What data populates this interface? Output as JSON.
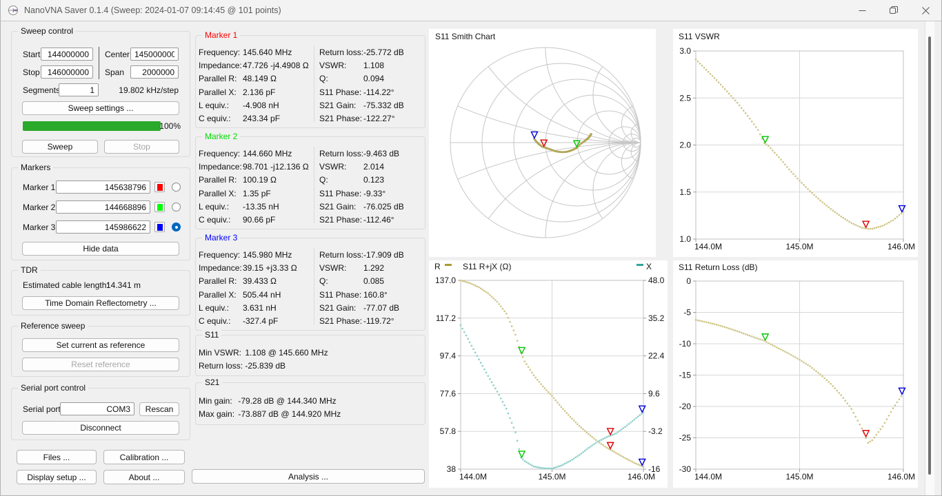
{
  "window": {
    "title": "NanoVNA Saver 0.1.4 (Sweep: 2024-01-07 09:14:45 @ 101 points)"
  },
  "sweep_control": {
    "title": "Sweep control",
    "start_label": "Start",
    "start_value": "144000000",
    "center_label": "Center",
    "center_value": "145000000",
    "stop_label": "Stop",
    "stop_value": "146000000",
    "span_label": "Span",
    "span_value": "2000000",
    "segments_label": "Segments",
    "segments_value": "1",
    "step_text": "19.802 kHz/step",
    "sweep_settings_button": "Sweep settings ...",
    "progress_percent": "100%",
    "sweep_button": "Sweep",
    "stop_button": "Stop"
  },
  "markers_control": {
    "title": "Markers",
    "items": [
      {
        "label": "Marker 1",
        "value": "145638796",
        "color": "#ff0000",
        "selected": false
      },
      {
        "label": "Marker 2",
        "value": "144668896",
        "color": "#00ff00",
        "selected": false
      },
      {
        "label": "Marker 3",
        "value": "145986622",
        "color": "#0000ff",
        "selected": true
      }
    ],
    "hide_data_button": "Hide data"
  },
  "tdr": {
    "title": "TDR",
    "cable_label": "Estimated cable length:",
    "cable_value": "14.341 m",
    "button": "Time Domain Reflectometry ..."
  },
  "reference_sweep": {
    "title": "Reference sweep",
    "set_button": "Set current as reference",
    "reset_button": "Reset reference"
  },
  "serial": {
    "title": "Serial port control",
    "port_label": "Serial port",
    "port_value": "COM3",
    "rescan_button": "Rescan",
    "disconnect_button": "Disconnect"
  },
  "footer_buttons": {
    "files": "Files ...",
    "calibration": "Calibration ...",
    "display_setup": "Display setup ...",
    "about": "About ...",
    "analysis": "Analysis ..."
  },
  "marker_panels": [
    {
      "title": "Marker 1",
      "color": "#ff0000",
      "left": [
        [
          "Frequency:",
          "145.640 MHz"
        ],
        [
          "Impedance:",
          "47.726 -j4.4908 Ω"
        ],
        [
          "Parallel R:",
          "48.149 Ω"
        ],
        [
          "Parallel X:",
          "2.136 pF"
        ],
        [
          "L equiv.:",
          "-4.908 nH"
        ],
        [
          "C equiv.:",
          "243.34 pF"
        ]
      ],
      "right": [
        [
          "Return loss:",
          "-25.772 dB"
        ],
        [
          "VSWR:",
          "1.108"
        ],
        [
          "Q:",
          "0.094"
        ],
        [
          "S11 Phase:",
          "-114.22°"
        ],
        [
          "S21 Gain:",
          "-75.332 dB"
        ],
        [
          "S21 Phase:",
          "-122.27°"
        ]
      ]
    },
    {
      "title": "Marker 2",
      "color": "#00dd00",
      "left": [
        [
          "Frequency:",
          "144.660 MHz"
        ],
        [
          "Impedance:",
          "98.701 -j12.136 Ω"
        ],
        [
          "Parallel R:",
          "100.19 Ω"
        ],
        [
          "Parallel X:",
          "1.35 pF"
        ],
        [
          "L equiv.:",
          "-13.35 nH"
        ],
        [
          "C equiv.:",
          "90.66 pF"
        ]
      ],
      "right": [
        [
          "Return loss:",
          "-9.463 dB"
        ],
        [
          "VSWR:",
          "2.014"
        ],
        [
          "Q:",
          "0.123"
        ],
        [
          "S11 Phase:",
          "-9.33°"
        ],
        [
          "S21 Gain:",
          "-76.025 dB"
        ],
        [
          "S21 Phase:",
          "-112.46°"
        ]
      ]
    },
    {
      "title": "Marker 3",
      "color": "#0000ff",
      "left": [
        [
          "Frequency:",
          "145.980 MHz"
        ],
        [
          "Impedance:",
          "39.15 +j3.33 Ω"
        ],
        [
          "Parallel R:",
          "39.433 Ω"
        ],
        [
          "Parallel X:",
          "505.44 nH"
        ],
        [
          "L equiv.:",
          "3.631 nH"
        ],
        [
          "C equiv.:",
          "-327.4 pF"
        ]
      ],
      "right": [
        [
          "Return loss:",
          "-17.909 dB"
        ],
        [
          "VSWR:",
          "1.292"
        ],
        [
          "Q:",
          "0.085"
        ],
        [
          "S11 Phase:",
          "160.8°"
        ],
        [
          "S21 Gain:",
          "-77.07 dB"
        ],
        [
          "S21 Phase:",
          "-119.72°"
        ]
      ]
    }
  ],
  "s11_panel": {
    "title": "S11",
    "rows": [
      [
        "Min VSWR:",
        "1.108 @ 145.660 MHz"
      ],
      [
        "Return loss:",
        "-25.839 dB"
      ]
    ]
  },
  "s21_panel": {
    "title": "S21",
    "rows": [
      [
        "Min gain:",
        "-79.28 dB @ 144.340 MHz"
      ],
      [
        "Max gain:",
        "-73.887 dB @ 144.920 MHz"
      ]
    ]
  },
  "chart_data": [
    {
      "id": "smith",
      "type": "smith",
      "title": "S11 Smith Chart",
      "z0": 50,
      "r_circles": [
        0.2,
        0.5,
        1,
        2,
        5,
        10,
        20
      ],
      "x_arcs": [
        0.2,
        0.5,
        1,
        2,
        5,
        10
      ],
      "trace_color": "#b3a75a",
      "impedance_source": "rjx",
      "markers": [
        {
          "color": "#00c400",
          "f": 144.6689
        },
        {
          "color": "#dc0000",
          "f": 145.6388
        },
        {
          "color": "#0000d8",
          "f": 145.9866
        }
      ]
    },
    {
      "id": "vswr",
      "type": "line",
      "title": "S11 VSWR",
      "xlim": [
        144.0,
        146.0
      ],
      "xticks": [
        {
          "v": 144.0,
          "label": "144.0M"
        },
        {
          "v": 145.0,
          "label": "145.0M"
        },
        {
          "v": 146.0,
          "label": "146.0M"
        }
      ],
      "axes": [
        {
          "side": "left",
          "lim": [
            1.0,
            3.0
          ],
          "ticks": [
            {
              "v": 3.0,
              "label": "3.0"
            },
            {
              "v": 2.5,
              "label": "2.5"
            },
            {
              "v": 2.0,
              "label": "2.0"
            },
            {
              "v": 1.5,
              "label": "1.5"
            },
            {
              "v": 1.0,
              "label": "1.0"
            }
          ]
        }
      ],
      "series": [
        {
          "name": "VSWR",
          "color": "#cfc589",
          "axis": 0,
          "x": [
            144.0,
            144.1,
            144.2,
            144.3,
            144.4,
            144.5,
            144.6,
            144.66,
            144.7,
            144.8,
            144.9,
            145.0,
            145.1,
            145.2,
            145.3,
            145.4,
            145.5,
            145.6,
            145.66,
            145.7,
            145.8,
            145.9,
            146.0
          ],
          "y": [
            2.91,
            2.8,
            2.69,
            2.57,
            2.45,
            2.31,
            2.16,
            2.02,
            1.99,
            1.87,
            1.74,
            1.62,
            1.51,
            1.41,
            1.32,
            1.24,
            1.17,
            1.12,
            1.108,
            1.11,
            1.14,
            1.2,
            1.29
          ]
        }
      ],
      "markers": [
        {
          "color": "#00c400",
          "f": 144.6689
        },
        {
          "color": "#dc0000",
          "f": 145.6388
        },
        {
          "color": "#0000d8",
          "f": 145.9866
        }
      ]
    },
    {
      "id": "rjx",
      "type": "line",
      "title": "S11 R+jX (Ω)",
      "legend": [
        {
          "label": "R",
          "color": "#ab9b2e"
        },
        {
          "label": "X",
          "color": "#2ea89a"
        }
      ],
      "xlim": [
        144.0,
        146.0
      ],
      "xticks": [
        {
          "v": 144.0,
          "label": "144.0M"
        },
        {
          "v": 145.0,
          "label": "145.0M"
        },
        {
          "v": 146.0,
          "label": "146.0M"
        }
      ],
      "axes": [
        {
          "side": "left",
          "lim": [
            38,
            137
          ],
          "ticks": [
            {
              "v": 137.0,
              "label": "137.0"
            },
            {
              "v": 117.2,
              "label": "117.2"
            },
            {
              "v": 97.4,
              "label": "97.4"
            },
            {
              "v": 77.6,
              "label": "77.6"
            },
            {
              "v": 57.8,
              "label": "57.8"
            },
            {
              "v": 38,
              "label": "38"
            }
          ]
        },
        {
          "side": "right",
          "lim": [
            -16,
            48
          ],
          "ticks": [
            {
              "v": 48.0,
              "label": "48.0"
            },
            {
              "v": 35.2,
              "label": "35.2"
            },
            {
              "v": 22.4,
              "label": "22.4"
            },
            {
              "v": 9.6,
              "label": "9.6"
            },
            {
              "v": -3.2,
              "label": "-3.2"
            },
            {
              "v": -16,
              "label": "-16"
            }
          ]
        }
      ],
      "series": [
        {
          "name": "R",
          "color": "#cfc589",
          "axis": 0,
          "x": [
            144.0,
            144.1,
            144.2,
            144.3,
            144.4,
            144.5,
            144.6,
            144.66,
            144.7,
            144.8,
            144.9,
            145.0,
            145.1,
            145.2,
            145.3,
            145.4,
            145.5,
            145.6,
            145.66,
            145.7,
            145.8,
            145.9,
            146.0
          ],
          "y": [
            137.0,
            135.6,
            133.4,
            130.2,
            125.8,
            119.6,
            108.5,
            99.0,
            94.5,
            87.2,
            81.4,
            76.4,
            70.6,
            65.4,
            60.6,
            56.4,
            52.5,
            49.2,
            47.6,
            46.5,
            43.8,
            41.3,
            39.2
          ]
        },
        {
          "name": "X",
          "color": "#8ecfc8",
          "axis": 1,
          "x": [
            144.0,
            144.1,
            144.2,
            144.3,
            144.4,
            144.5,
            144.6,
            144.66,
            144.7,
            144.8,
            144.9,
            145.0,
            145.1,
            145.2,
            145.3,
            145.4,
            145.5,
            145.6,
            145.66,
            145.7,
            145.8,
            145.9,
            146.0
          ],
          "y": [
            32.8,
            27.0,
            21.2,
            15.6,
            10.3,
            4.5,
            -3.5,
            -12.1,
            -13.3,
            -15.1,
            -15.7,
            -15.8,
            -14.8,
            -13.2,
            -11.2,
            -8.8,
            -6.7,
            -5.1,
            -4.4,
            -3.9,
            -1.7,
            0.8,
            3.3
          ]
        }
      ],
      "markers": [
        {
          "color": "#00c400",
          "f": 144.6689
        },
        {
          "color": "#dc0000",
          "f": 145.6388
        },
        {
          "color": "#0000d8",
          "f": 145.9866
        }
      ]
    },
    {
      "id": "rl",
      "type": "line",
      "title": "S11 Return Loss (dB)",
      "xlim": [
        144.0,
        146.0
      ],
      "xticks": [
        {
          "v": 144.0,
          "label": "144.0M"
        },
        {
          "v": 145.0,
          "label": "145.0M"
        },
        {
          "v": 146.0,
          "label": "146.0M"
        }
      ],
      "axes": [
        {
          "side": "left",
          "lim": [
            -30,
            0
          ],
          "ticks": [
            {
              "v": 0,
              "label": "0"
            },
            {
              "v": -5,
              "label": "-5"
            },
            {
              "v": -10,
              "label": "-10"
            },
            {
              "v": -15,
              "label": "-15"
            },
            {
              "v": -20,
              "label": "-20"
            },
            {
              "v": -25,
              "label": "-25"
            },
            {
              "v": -30,
              "label": "-30"
            }
          ]
        }
      ],
      "series": [
        {
          "name": "Return loss",
          "color": "#cfc589",
          "axis": 0,
          "x": [
            144.0,
            144.1,
            144.2,
            144.3,
            144.4,
            144.5,
            144.6,
            144.66,
            144.7,
            144.8,
            144.9,
            145.0,
            145.1,
            145.2,
            145.3,
            145.4,
            145.5,
            145.6,
            145.66,
            145.7,
            145.8,
            145.9,
            146.0
          ],
          "y": [
            -6.2,
            -6.55,
            -6.95,
            -7.45,
            -8.0,
            -8.6,
            -9.2,
            -9.5,
            -9.9,
            -10.75,
            -11.6,
            -12.55,
            -13.6,
            -14.9,
            -16.4,
            -18.2,
            -20.4,
            -23.5,
            -25.8,
            -25.4,
            -23.2,
            -20.3,
            -17.9
          ]
        }
      ],
      "markers": [
        {
          "color": "#00c400",
          "f": 144.6689
        },
        {
          "color": "#dc0000",
          "f": 145.6388
        },
        {
          "color": "#0000d8",
          "f": 145.9866
        }
      ]
    }
  ]
}
